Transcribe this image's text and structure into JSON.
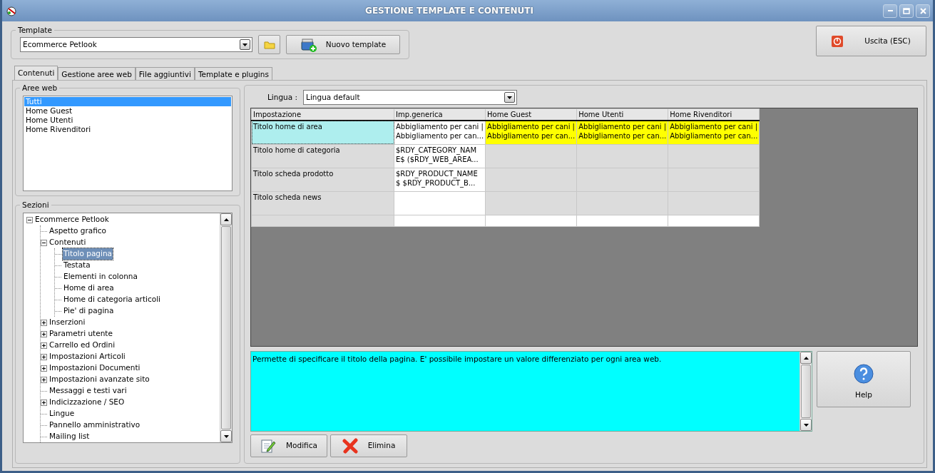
{
  "window": {
    "title": "GESTIONE TEMPLATE E CONTENUTI"
  },
  "template": {
    "legend": "Template",
    "value": "Ecommerce Petlook",
    "new_button": "Nuovo template"
  },
  "exit_button": "Uscita (ESC)",
  "tabs": [
    {
      "label": "Contenuti",
      "selected": true
    },
    {
      "label": "Gestione aree web",
      "selected": false
    },
    {
      "label": "File aggiuntivi",
      "selected": false
    },
    {
      "label": "Template e plugins",
      "selected": false
    }
  ],
  "web_areas": {
    "legend": "Aree web",
    "items": [
      {
        "label": "Tutti",
        "selected": true
      },
      {
        "label": "Home Guest",
        "selected": false
      },
      {
        "label": "Home Utenti",
        "selected": false
      },
      {
        "label": "Home Rivenditori",
        "selected": false
      }
    ]
  },
  "sections": {
    "legend": "Sezioni",
    "tree": [
      {
        "label": "Ecommerce Petlook",
        "kind": "node",
        "expanded": true,
        "selected": false,
        "children": [
          {
            "label": "Aspetto grafico",
            "kind": "leaf",
            "selected": false
          },
          {
            "label": "Contenuti",
            "kind": "node",
            "expanded": true,
            "selected": false,
            "children": [
              {
                "label": "Titolo pagina",
                "kind": "leaf",
                "selected": true
              },
              {
                "label": "Testata",
                "kind": "leaf",
                "selected": false
              },
              {
                "label": "Elementi in colonna",
                "kind": "leaf",
                "selected": false
              },
              {
                "label": "Home di area",
                "kind": "leaf",
                "selected": false
              },
              {
                "label": "Home di categoria articoli",
                "kind": "leaf",
                "selected": false
              },
              {
                "label": "Pie' di pagina",
                "kind": "leaf",
                "selected": false
              }
            ]
          },
          {
            "label": "Inserzioni",
            "kind": "node",
            "expanded": false,
            "selected": false
          },
          {
            "label": "Parametri utente",
            "kind": "node",
            "expanded": false,
            "selected": false
          },
          {
            "label": "Carrello ed Ordini",
            "kind": "node",
            "expanded": false,
            "selected": false
          },
          {
            "label": "Impostazioni Articoli",
            "kind": "node",
            "expanded": false,
            "selected": false
          },
          {
            "label": "Impostazioni Documenti",
            "kind": "node",
            "expanded": false,
            "selected": false
          },
          {
            "label": "Impostazioni avanzate sito",
            "kind": "node",
            "expanded": false,
            "selected": false
          },
          {
            "label": "Messaggi e testi vari",
            "kind": "leaf",
            "selected": false
          },
          {
            "label": "Indicizzazione / SEO",
            "kind": "node",
            "expanded": false,
            "selected": false
          },
          {
            "label": "Lingue",
            "kind": "leaf",
            "selected": false
          },
          {
            "label": "Pannello amministrativo",
            "kind": "leaf",
            "selected": false
          },
          {
            "label": "Mailing list",
            "kind": "leaf",
            "selected": false
          }
        ]
      }
    ]
  },
  "language": {
    "label": "Lingua :",
    "value": "Lingua default"
  },
  "table": {
    "columns": [
      "Impostazione",
      "Imp.generica",
      "Home Guest",
      "Home Utenti",
      "Home Rivenditori"
    ],
    "rows": [
      {
        "selected": true,
        "cells": [
          {
            "text": "Titolo home di area",
            "color": "#aeeeee"
          },
          {
            "text": "Abbigliamento per cani |\nAbbigliamento per can...",
            "color": "#ffffff"
          },
          {
            "text": "Abbigliamento per cani |\nAbbigliamento per can...",
            "color": "#ffff00"
          },
          {
            "text": "Abbigliamento per cani |\nAbbigliamento per can...",
            "color": "#ffff00"
          },
          {
            "text": "Abbigliamento per cani |\nAbbigliamento per can...",
            "color": "#ffff00"
          }
        ]
      },
      {
        "selected": false,
        "cells": [
          {
            "text": "Titolo home di categoria",
            "color": "#dcdcdc"
          },
          {
            "text": "$RDY_CATEGORY_NAM\nE$ ($RDY_WEB_AREA...",
            "color": "#ffffff"
          },
          {
            "color": "#dcdcdc"
          },
          {
            "color": "#dcdcdc"
          },
          {
            "color": "#dcdcdc"
          }
        ]
      },
      {
        "selected": false,
        "cells": [
          {
            "text": "Titolo scheda prodotto",
            "color": "#dcdcdc"
          },
          {
            "text": "$RDY_PRODUCT_NAME\n$ $RDY_PRODUCT_B...",
            "color": "#ffffff"
          },
          {
            "color": "#dcdcdc"
          },
          {
            "color": "#dcdcdc"
          },
          {
            "color": "#dcdcdc"
          }
        ]
      },
      {
        "selected": false,
        "cells": [
          {
            "text": "Titolo scheda news",
            "color": "#dcdcdc"
          },
          {
            "color": "#ffffff"
          },
          {
            "color": "#dcdcdc"
          },
          {
            "color": "#dcdcdc"
          },
          {
            "color": "#dcdcdc"
          }
        ]
      },
      {
        "selected": false,
        "cells": [
          {
            "color": "#dcdcdc"
          },
          {
            "color": "#ffffff"
          },
          {
            "color": "#ffffff"
          },
          {
            "color": "#ffffff"
          },
          {
            "color": "#ffffff"
          }
        ]
      }
    ]
  },
  "description": "Permette di specificare il titolo della pagina. E' possibile impostare un valore differenziato per ogni area web.",
  "help_button": "Help",
  "buttons": [
    {
      "label": "Modifica",
      "kind": "edit"
    },
    {
      "label": "Elimina",
      "kind": "delete"
    }
  ]
}
